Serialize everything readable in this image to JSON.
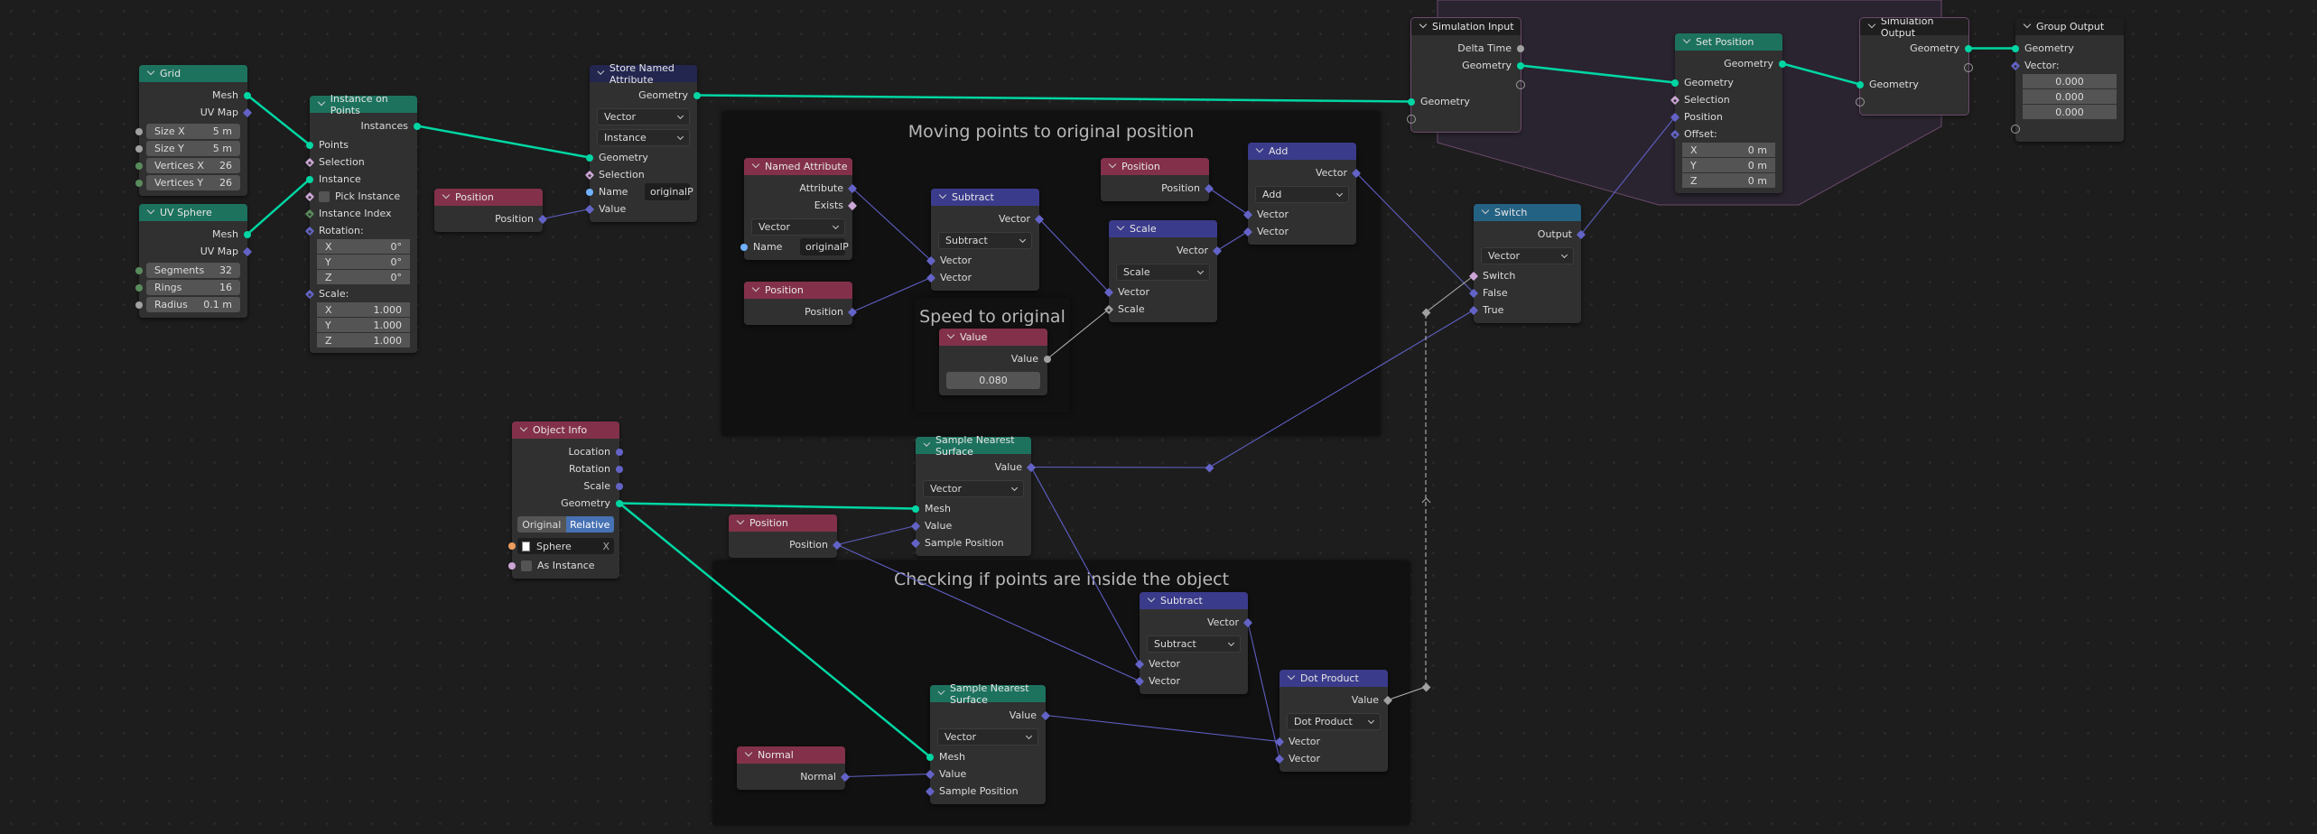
{
  "socket_colors": {
    "geometry": "#00d6a3",
    "vector": "#6363c7",
    "float": "#a1a1a1",
    "bool": "#cca6d6",
    "string": "#70b2ff",
    "int": "#598c5c",
    "object": "#ed9e5c",
    "virtual": "#9a9a9a"
  },
  "frames": [
    {
      "id": "f1",
      "label": "Moving points to original position"
    },
    {
      "id": "f2",
      "label": "Speed to original pos"
    },
    {
      "id": "f3",
      "label": "Checking if points are inside the object"
    }
  ],
  "nodes": [
    {
      "id": "grid",
      "title": "Grid",
      "color": "#1d725e",
      "rows": [
        {
          "t": "out",
          "label": "Mesh",
          "sock": "geometry",
          "shape": "circle"
        },
        {
          "t": "out",
          "label": "UV Map",
          "sock": "vector",
          "shape": "diamond"
        },
        {
          "t": "field",
          "label": "Size X",
          "value": "5 m",
          "sock": "float",
          "shape": "circle"
        },
        {
          "t": "field",
          "label": "Size Y",
          "value": "5 m",
          "sock": "float",
          "shape": "circle"
        },
        {
          "t": "field",
          "label": "Vertices X",
          "value": "26",
          "sock": "int",
          "shape": "circle"
        },
        {
          "t": "field",
          "label": "Vertices Y",
          "value": "26",
          "sock": "int",
          "shape": "circle"
        }
      ]
    },
    {
      "id": "uvs",
      "title": "UV Sphere",
      "color": "#1d725e",
      "rows": [
        {
          "t": "out",
          "label": "Mesh",
          "sock": "geometry",
          "shape": "circle"
        },
        {
          "t": "out",
          "label": "UV Map",
          "sock": "vector",
          "shape": "diamond"
        },
        {
          "t": "field",
          "label": "Segments",
          "value": "32",
          "sock": "int",
          "shape": "circle"
        },
        {
          "t": "field",
          "label": "Rings",
          "value": "16",
          "sock": "int",
          "shape": "circle"
        },
        {
          "t": "field",
          "label": "Radius",
          "value": "0.1 m",
          "sock": "float",
          "shape": "circle"
        }
      ]
    },
    {
      "id": "iop",
      "title": "Instance on Points",
      "color": "#1d725e",
      "rows": [
        {
          "t": "out",
          "label": "Instances",
          "sock": "geometry",
          "shape": "circle"
        },
        {
          "t": "in",
          "label": "Points",
          "sock": "geometry",
          "shape": "circle"
        },
        {
          "t": "in",
          "label": "Selection",
          "sock": "bool",
          "shape": "diamond-dot"
        },
        {
          "t": "in",
          "label": "Instance",
          "sock": "geometry",
          "shape": "circle"
        },
        {
          "t": "check",
          "label": "Pick Instance",
          "sock": "bool",
          "shape": "diamond-dot"
        },
        {
          "t": "in",
          "label": "Instance Index",
          "sock": "int",
          "shape": "diamond-dot"
        },
        {
          "t": "label",
          "label": "Rotation:",
          "sock": "vector",
          "shape": "diamond-dot"
        },
        {
          "t": "xyz",
          "label": "X",
          "value": "0°"
        },
        {
          "t": "xyz",
          "label": "Y",
          "value": "0°"
        },
        {
          "t": "xyz",
          "label": "Z",
          "value": "0°"
        },
        {
          "t": "label",
          "label": "Scale:",
          "sock": "vector",
          "shape": "diamond-dot"
        },
        {
          "t": "xyz",
          "label": "X",
          "value": "1.000"
        },
        {
          "t": "xyz",
          "label": "Y",
          "value": "1.000"
        },
        {
          "t": "xyz",
          "label": "Z",
          "value": "1.000"
        }
      ]
    },
    {
      "id": "pos1",
      "title": "Position",
      "color": "#83314a",
      "rows": [
        {
          "t": "out",
          "label": "Position",
          "sock": "vector",
          "shape": "diamond"
        }
      ]
    },
    {
      "id": "sna",
      "title": "Store Named Attribute",
      "color": "#23264f",
      "rows": [
        {
          "t": "out",
          "label": "Geometry",
          "sock": "geometry",
          "shape": "circle"
        },
        {
          "t": "select",
          "value": "Vector"
        },
        {
          "t": "select2",
          "value": "Instance"
        },
        {
          "t": "in",
          "label": "Geometry",
          "sock": "geometry",
          "shape": "circle"
        },
        {
          "t": "in",
          "label": "Selection",
          "sock": "bool",
          "shape": "diamond-dot"
        },
        {
          "t": "name",
          "label": "Name",
          "value": "originalP",
          "sock": "string",
          "shape": "circle"
        },
        {
          "t": "in",
          "label": "Value",
          "sock": "vector",
          "shape": "diamond"
        }
      ]
    },
    {
      "id": "named",
      "title": "Named Attribute",
      "color": "#83314a",
      "rows": [
        {
          "t": "out",
          "label": "Attribute",
          "sock": "vector",
          "shape": "diamond"
        },
        {
          "t": "out",
          "label": "Exists",
          "sock": "bool",
          "shape": "diamond"
        },
        {
          "t": "select",
          "value": "Vector"
        },
        {
          "t": "name",
          "label": "Name",
          "value": "originalP",
          "sock": "string",
          "shape": "circle"
        }
      ]
    },
    {
      "id": "pos2",
      "title": "Position",
      "color": "#83314a",
      "rows": [
        {
          "t": "out",
          "label": "Position",
          "sock": "vector",
          "shape": "diamond"
        }
      ]
    },
    {
      "id": "sub1",
      "title": "Subtract",
      "color": "#3b3b8c",
      "rows": [
        {
          "t": "out",
          "label": "Vector",
          "sock": "vector",
          "shape": "diamond"
        },
        {
          "t": "select",
          "value": "Subtract"
        },
        {
          "t": "in",
          "label": "Vector",
          "sock": "vector",
          "shape": "diamond"
        },
        {
          "t": "in",
          "label": "Vector",
          "sock": "vector",
          "shape": "diamond"
        }
      ]
    },
    {
      "id": "val",
      "title": "Value",
      "color": "#83314a",
      "rows": [
        {
          "t": "out",
          "label": "Value",
          "sock": "float",
          "shape": "circle"
        },
        {
          "t": "num",
          "value": "0.080"
        }
      ]
    },
    {
      "id": "pos3",
      "title": "Position",
      "color": "#83314a",
      "rows": [
        {
          "t": "out",
          "label": "Position",
          "sock": "vector",
          "shape": "diamond"
        }
      ]
    },
    {
      "id": "scale",
      "title": "Scale",
      "color": "#3b3b8c",
      "rows": [
        {
          "t": "out",
          "label": "Vector",
          "sock": "vector",
          "shape": "diamond"
        },
        {
          "t": "select",
          "value": "Scale"
        },
        {
          "t": "in",
          "label": "Vector",
          "sock": "vector",
          "shape": "diamond"
        },
        {
          "t": "in",
          "label": "Scale",
          "sock": "float",
          "shape": "diamond-dot"
        }
      ]
    },
    {
      "id": "add",
      "title": "Add",
      "color": "#3b3b8c",
      "rows": [
        {
          "t": "out",
          "label": "Vector",
          "sock": "vector",
          "shape": "diamond"
        },
        {
          "t": "select",
          "value": "Add"
        },
        {
          "t": "in",
          "label": "Vector",
          "sock": "vector",
          "shape": "diamond"
        },
        {
          "t": "in",
          "label": "Vector",
          "sock": "vector",
          "shape": "diamond"
        }
      ]
    },
    {
      "id": "simin",
      "title": "Simulation Input",
      "color": "#1e1e1e",
      "sim": true,
      "rows": [
        {
          "t": "out",
          "label": "Delta Time",
          "sock": "float",
          "shape": "circle"
        },
        {
          "t": "out",
          "label": "Geometry",
          "sock": "geometry",
          "shape": "circle"
        },
        {
          "t": "vout"
        },
        {
          "t": "in",
          "label": "Geometry",
          "sock": "geometry",
          "shape": "circle"
        },
        {
          "t": "vin"
        }
      ]
    },
    {
      "id": "setpos",
      "title": "Set Position",
      "color": "#1d725e",
      "rows": [
        {
          "t": "out",
          "label": "Geometry",
          "sock": "geometry",
          "shape": "circle"
        },
        {
          "t": "in",
          "label": "Geometry",
          "sock": "geometry",
          "shape": "circle"
        },
        {
          "t": "in",
          "label": "Selection",
          "sock": "bool",
          "shape": "diamond-dot"
        },
        {
          "t": "in",
          "label": "Position",
          "sock": "vector",
          "shape": "diamond"
        },
        {
          "t": "label",
          "label": "Offset:",
          "sock": "vector",
          "shape": "diamond-dot"
        },
        {
          "t": "xyz",
          "label": "X",
          "value": "0 m"
        },
        {
          "t": "xyz",
          "label": "Y",
          "value": "0 m"
        },
        {
          "t": "xyz",
          "label": "Z",
          "value": "0 m"
        }
      ]
    },
    {
      "id": "simout",
      "title": "Simulation Output",
      "color": "#1e1e1e",
      "sim": true,
      "rows": [
        {
          "t": "out",
          "label": "Geometry",
          "sock": "geometry",
          "shape": "circle"
        },
        {
          "t": "vout"
        },
        {
          "t": "in",
          "label": "Geometry",
          "sock": "geometry",
          "shape": "circle"
        },
        {
          "t": "vin"
        }
      ]
    },
    {
      "id": "gout",
      "title": "Group Output",
      "color": "#1e1e1e",
      "rows": [
        {
          "t": "in",
          "label": "Geometry",
          "sock": "geometry",
          "shape": "circle"
        },
        {
          "t": "label",
          "label": "Vector:",
          "sock": "vector",
          "shape": "diamond-dot"
        },
        {
          "t": "xyz",
          "label": "",
          "value": "0.000"
        },
        {
          "t": "xyz",
          "label": "",
          "value": "0.000"
        },
        {
          "t": "xyz",
          "label": "",
          "value": "0.000"
        },
        {
          "t": "vin"
        }
      ]
    },
    {
      "id": "switch",
      "title": "Switch",
      "color": "#246283",
      "rows": [
        {
          "t": "out",
          "label": "Output",
          "sock": "vector",
          "shape": "diamond"
        },
        {
          "t": "select",
          "value": "Vector"
        },
        {
          "t": "in",
          "label": "Switch",
          "sock": "bool",
          "shape": "diamond"
        },
        {
          "t": "in",
          "label": "False",
          "sock": "vector",
          "shape": "diamond"
        },
        {
          "t": "in",
          "label": "True",
          "sock": "vector",
          "shape": "diamond"
        }
      ]
    },
    {
      "id": "obj",
      "title": "Object Info",
      "color": "#83314a",
      "rows": [
        {
          "t": "out",
          "label": "Location",
          "sock": "vector",
          "shape": "circle"
        },
        {
          "t": "out",
          "label": "Rotation",
          "sock": "vector",
          "shape": "circle"
        },
        {
          "t": "out",
          "label": "Scale",
          "sock": "vector",
          "shape": "circle"
        },
        {
          "t": "out",
          "label": "Geometry",
          "sock": "geometry",
          "shape": "circle"
        },
        {
          "t": "toggle",
          "options": [
            "Original",
            "Relative"
          ],
          "selected": "Relative"
        },
        {
          "t": "object",
          "value": "Sphere",
          "sock": "object",
          "shape": "circle",
          "clear": "X"
        },
        {
          "t": "check",
          "label": "As Instance",
          "sock": "bool",
          "shape": "circle"
        }
      ]
    },
    {
      "id": "sns1",
      "title": "Sample Nearest Surface",
      "color": "#1d725e",
      "rows": [
        {
          "t": "out",
          "label": "Value",
          "sock": "vector",
          "shape": "diamond"
        },
        {
          "t": "select",
          "value": "Vector"
        },
        {
          "t": "in",
          "label": "Mesh",
          "sock": "geometry",
          "shape": "circle"
        },
        {
          "t": "in",
          "label": "Value",
          "sock": "vector",
          "shape": "diamond"
        },
        {
          "t": "in",
          "label": "Sample Position",
          "sock": "vector",
          "shape": "diamond"
        }
      ]
    },
    {
      "id": "pos4",
      "title": "Position",
      "color": "#83314a",
      "rows": [
        {
          "t": "out",
          "label": "Position",
          "sock": "vector",
          "shape": "diamond"
        }
      ]
    },
    {
      "id": "sub2",
      "title": "Subtract",
      "color": "#3b3b8c",
      "rows": [
        {
          "t": "out",
          "label": "Vector",
          "sock": "vector",
          "shape": "diamond"
        },
        {
          "t": "select",
          "value": "Subtract"
        },
        {
          "t": "in",
          "label": "Vector",
          "sock": "vector",
          "shape": "diamond"
        },
        {
          "t": "in",
          "label": "Vector",
          "sock": "vector",
          "shape": "diamond"
        }
      ]
    },
    {
      "id": "dot",
      "title": "Dot Product",
      "color": "#3b3b8c",
      "rows": [
        {
          "t": "out",
          "label": "Value",
          "sock": "float",
          "shape": "diamond"
        },
        {
          "t": "select",
          "value": "Dot Product"
        },
        {
          "t": "in",
          "label": "Vector",
          "sock": "vector",
          "shape": "diamond"
        },
        {
          "t": "in",
          "label": "Vector",
          "sock": "vector",
          "shape": "diamond"
        }
      ]
    },
    {
      "id": "sns2",
      "title": "Sample Nearest Surface",
      "color": "#1d725e",
      "rows": [
        {
          "t": "out",
          "label": "Value",
          "sock": "vector",
          "shape": "diamond"
        },
        {
          "t": "select",
          "value": "Vector"
        },
        {
          "t": "in",
          "label": "Mesh",
          "sock": "geometry",
          "shape": "circle"
        },
        {
          "t": "in",
          "label": "Value",
          "sock": "vector",
          "shape": "diamond"
        },
        {
          "t": "in",
          "label": "Sample Position",
          "sock": "vector",
          "shape": "diamond"
        }
      ]
    },
    {
      "id": "normal",
      "title": "Normal",
      "color": "#83314a",
      "rows": [
        {
          "t": "out",
          "label": "Normal",
          "sock": "vector",
          "shape": "diamond"
        }
      ]
    }
  ],
  "reroutes": [
    {
      "id": "r1",
      "sock": "vector"
    },
    {
      "id": "r2",
      "sock": "float"
    },
    {
      "id": "r3",
      "sock": "float"
    }
  ],
  "links": [
    {
      "from": "grid.out.0",
      "to": "iop.in.0",
      "type": "geometry"
    },
    {
      "from": "uvs.out.0",
      "to": "iop.in.2",
      "type": "geometry"
    },
    {
      "from": "iop.out.0",
      "to": "sna.in.0",
      "type": "geometry"
    },
    {
      "from": "pos1.out.0",
      "to": "sna.in.3",
      "type": "vector"
    },
    {
      "from": "sna.out.0",
      "to": "simin.in.0",
      "type": "geometry"
    },
    {
      "from": "simin.out.1",
      "to": "setpos.in.0",
      "type": "geometry"
    },
    {
      "from": "setpos.out.0",
      "to": "simout.in.0",
      "type": "geometry"
    },
    {
      "from": "simout.out.0",
      "to": "gout.in.0",
      "type": "geometry"
    },
    {
      "from": "named.out.0",
      "to": "sub1.in.0",
      "type": "vector"
    },
    {
      "from": "pos2.out.0",
      "to": "sub1.in.1",
      "type": "vector"
    },
    {
      "from": "sub1.out.0",
      "to": "scale.in.0",
      "type": "vector"
    },
    {
      "from": "val.out.0",
      "to": "scale.in.1",
      "type": "float"
    },
    {
      "from": "pos3.out.0",
      "to": "add.in.0",
      "type": "vector"
    },
    {
      "from": "scale.out.0",
      "to": "add.in.1",
      "type": "vector"
    },
    {
      "from": "add.out.0",
      "to": "switch.in.1",
      "type": "vector"
    },
    {
      "from": "switch.out.0",
      "to": "setpos.in.2",
      "type": "vector"
    },
    {
      "from": "obj.out.3",
      "to": "sns1.in.0",
      "type": "geometry"
    },
    {
      "from": "obj.out.3",
      "to": "sns2.in.0",
      "type": "geometry"
    },
    {
      "from": "pos4.out.0",
      "to": "sns1.in.1",
      "type": "vector"
    },
    {
      "from": "pos4.out.0",
      "to": "sub2.in.1",
      "type": "vector"
    },
    {
      "from": "sns1.out.0",
      "to": "r1",
      "type": "vector"
    },
    {
      "from": "r1",
      "to": "switch.in.2",
      "type": "vector"
    },
    {
      "from": "sns1.out.0",
      "to": "sub2.in.0",
      "type": "vector"
    },
    {
      "from": "sub2.out.0",
      "to": "dot.in.1",
      "type": "vector"
    },
    {
      "from": "sns2.out.0",
      "to": "dot.in.0",
      "type": "vector"
    },
    {
      "from": "normal.out.0",
      "to": "sns2.in.1",
      "type": "vector"
    },
    {
      "from": "dot.out.0",
      "to": "r2",
      "type": "float"
    },
    {
      "from": "r2",
      "to": "r3",
      "type": "float",
      "dashed": true
    },
    {
      "from": "r3",
      "to": "switch.in.0",
      "type": "float"
    }
  ]
}
